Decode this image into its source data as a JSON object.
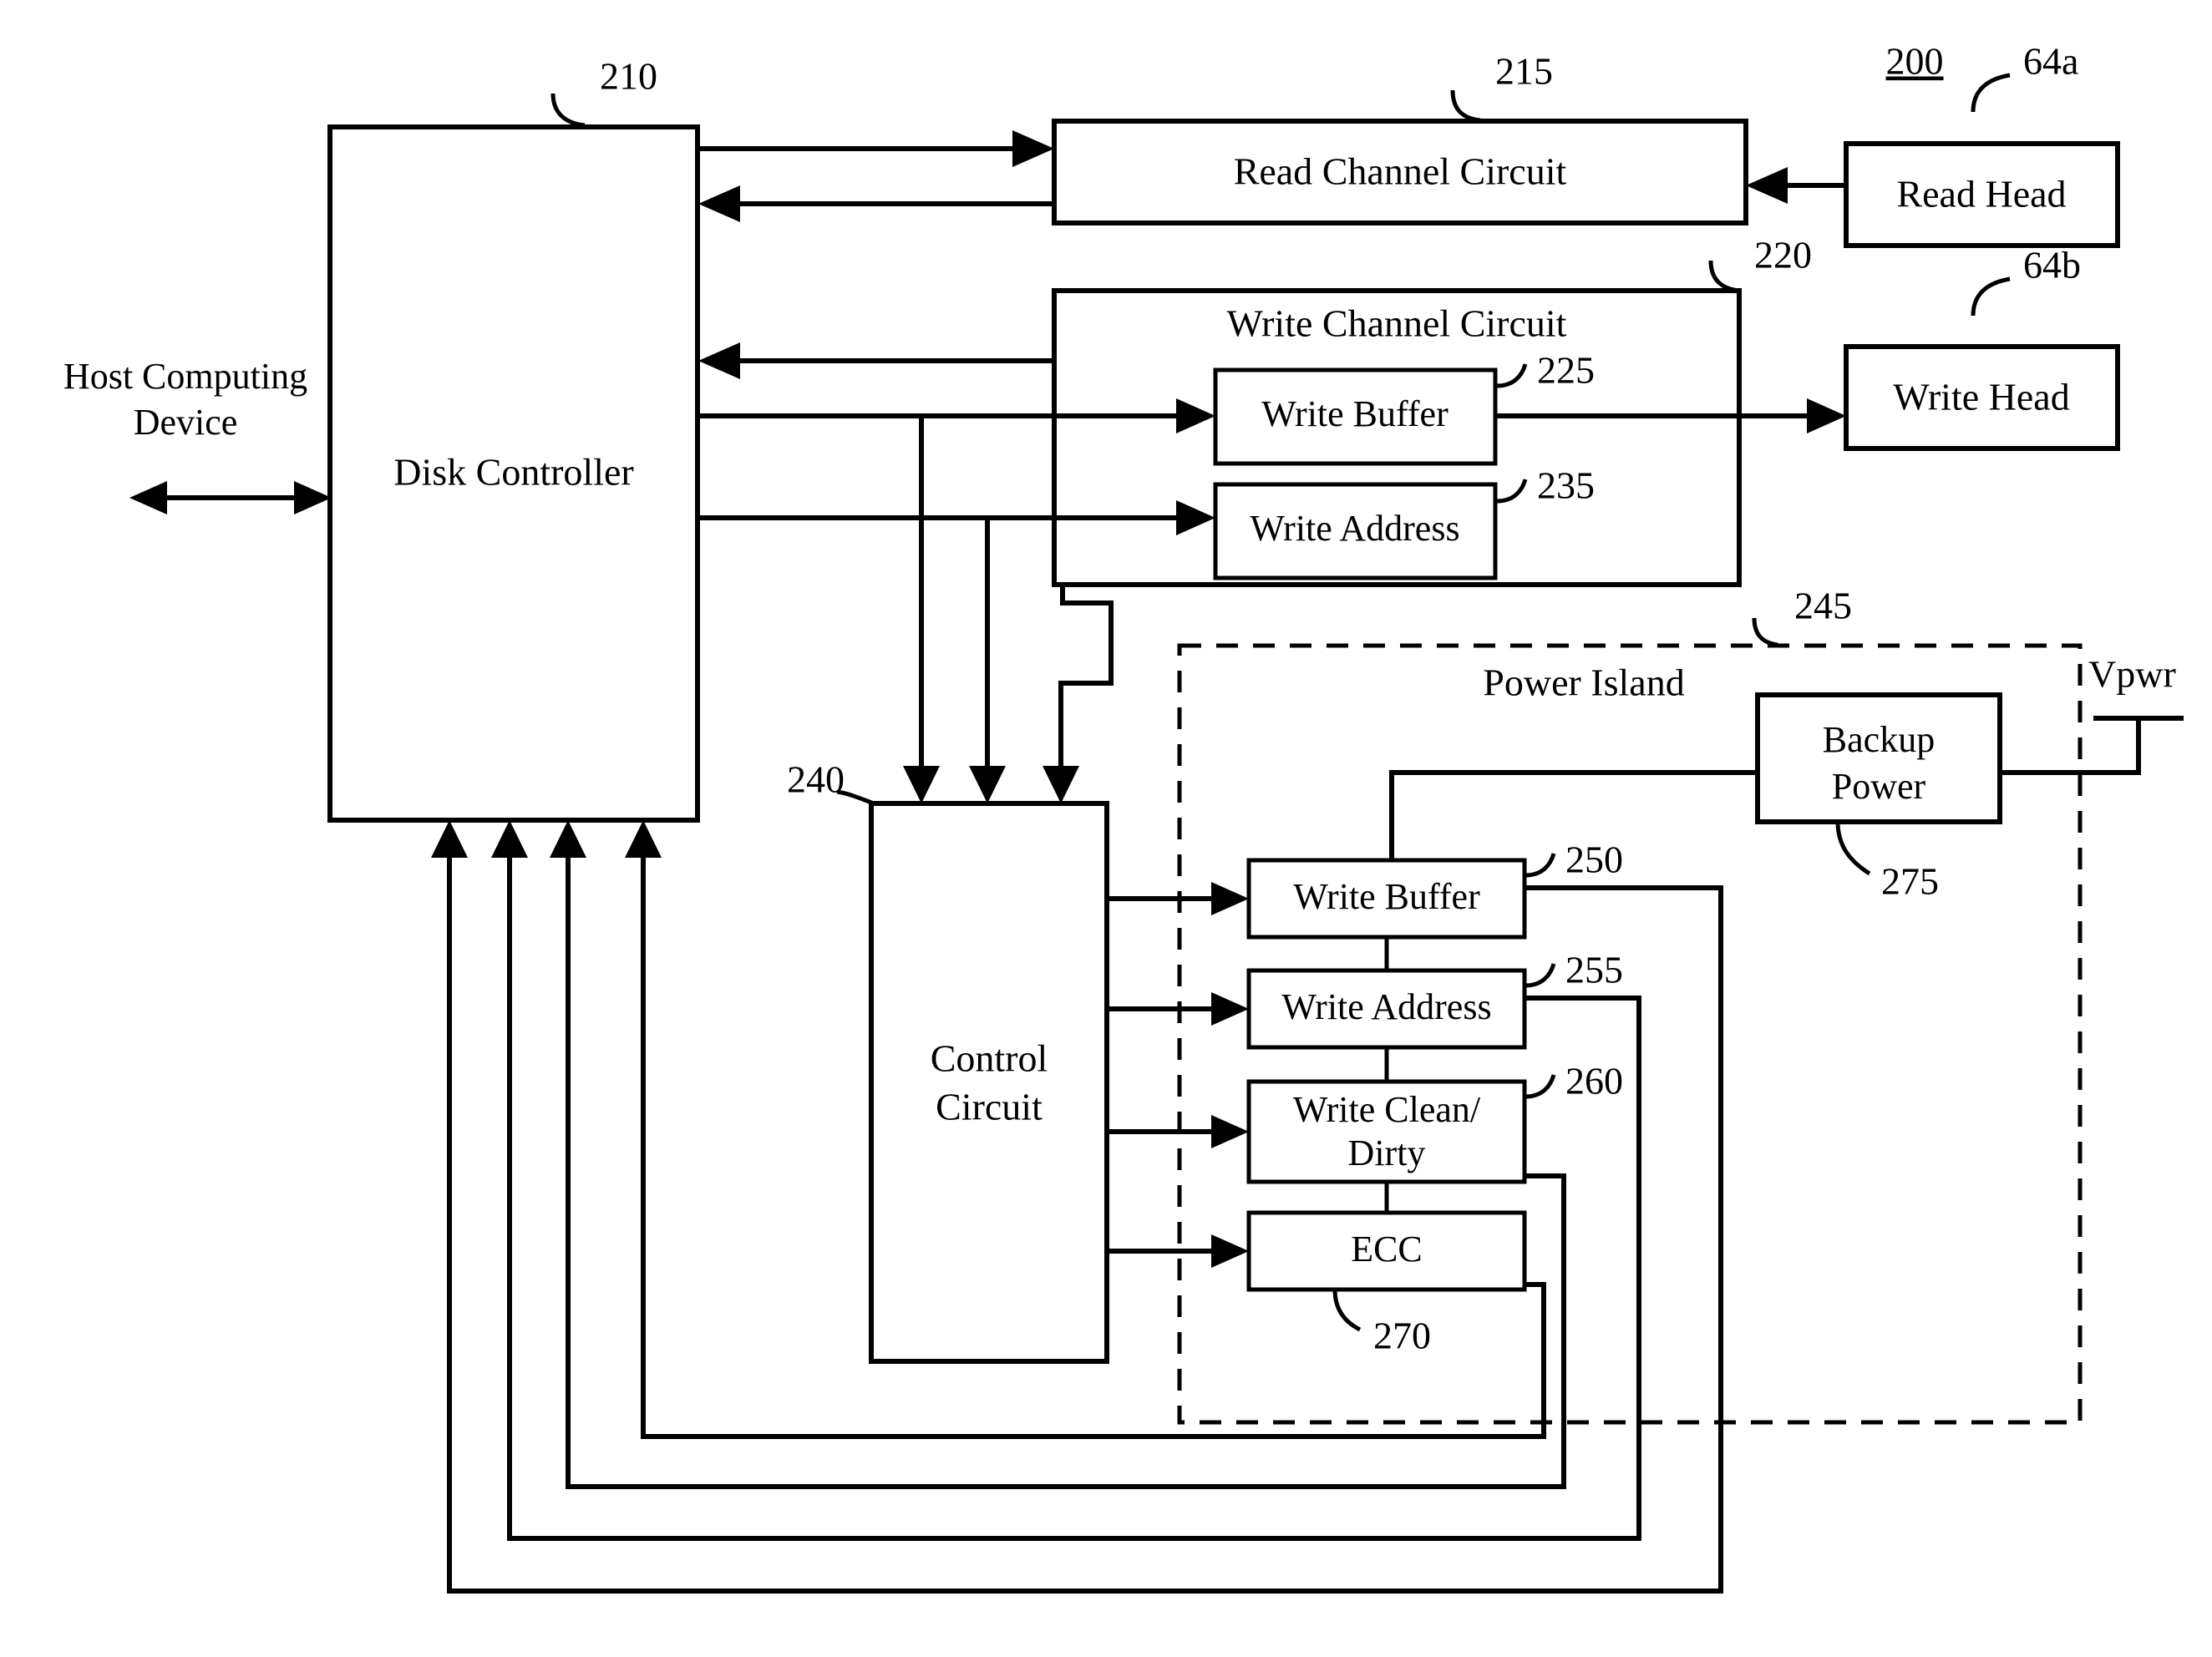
{
  "figure": {
    "figure_number": "200",
    "type": "patent-block-diagram",
    "description": "Disk drive system block diagram with power island"
  },
  "blocks": {
    "host": {
      "label_line1": "Host Computing",
      "label_line2": "Device"
    },
    "disk_controller": {
      "label": "Disk Controller",
      "ref": "210"
    },
    "read_channel": {
      "label": "Read Channel Circuit",
      "ref": "215"
    },
    "read_head": {
      "label": "Read Head",
      "ref": "64a"
    },
    "write_channel": {
      "label": "Write Channel Circuit",
      "ref": "220"
    },
    "write_buffer_wc": {
      "label": "Write Buffer",
      "ref": "225"
    },
    "write_address_wc": {
      "label": "Write Address",
      "ref": "235"
    },
    "write_head": {
      "label": "Write Head",
      "ref": "64b"
    },
    "control_circuit": {
      "label_line1": "Control",
      "label_line2": "Circuit",
      "ref": "240"
    },
    "power_island": {
      "label": "Power Island",
      "ref": "245"
    },
    "write_buffer_pi": {
      "label": "Write Buffer",
      "ref": "250"
    },
    "write_address_pi": {
      "label": "Write Address",
      "ref": "255"
    },
    "write_clean_dirty": {
      "label_line1": "Write Clean/",
      "label_line2": "Dirty",
      "ref": "260"
    },
    "ecc": {
      "label": "ECC",
      "ref": "270"
    },
    "backup_power": {
      "label_line1": "Backup",
      "label_line2": "Power",
      "ref": "275"
    },
    "vpwr": {
      "label": "Vpwr"
    }
  },
  "colors": {
    "line": "#000000",
    "fill": "#ffffff",
    "background": "#ffffff"
  }
}
